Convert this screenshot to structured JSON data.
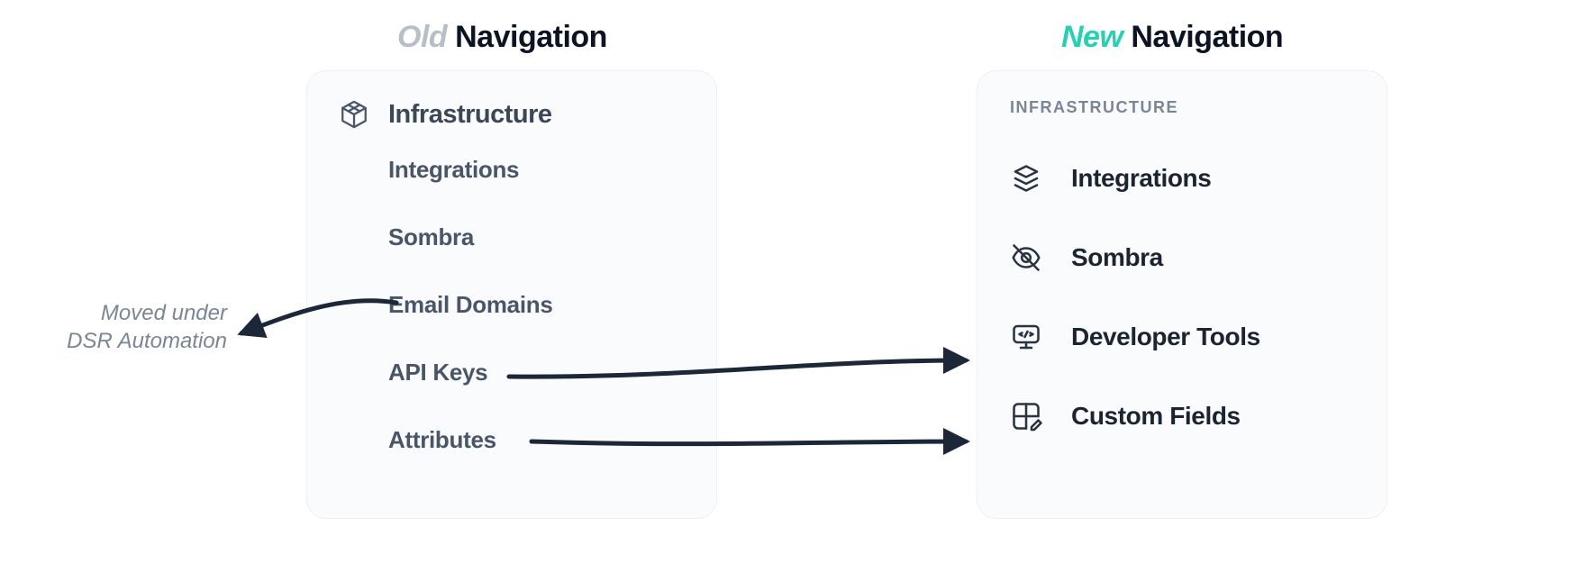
{
  "headings": {
    "old": {
      "prefix": "Old",
      "word": "Navigation"
    },
    "new": {
      "prefix": "New",
      "word": "Navigation"
    }
  },
  "old_nav": {
    "header": "Infrastructure",
    "items": [
      {
        "label": "Integrations"
      },
      {
        "label": "Sombra"
      },
      {
        "label": "Email Domains"
      },
      {
        "label": "API Keys"
      },
      {
        "label": "Attributes"
      }
    ]
  },
  "new_nav": {
    "section_label": "INFRASTRUCTURE",
    "items": [
      {
        "label": "Integrations",
        "icon": "layers"
      },
      {
        "label": "Sombra",
        "icon": "eye-off"
      },
      {
        "label": "Developer Tools",
        "icon": "code-monitor"
      },
      {
        "label": "Custom Fields",
        "icon": "grid-edit"
      }
    ]
  },
  "annotation": {
    "line1": "Moved under",
    "line2": "DSR Automation"
  },
  "colors": {
    "accent_new": "#27cfb3",
    "muted": "#b8bec8",
    "arrow": "#1c2838"
  }
}
